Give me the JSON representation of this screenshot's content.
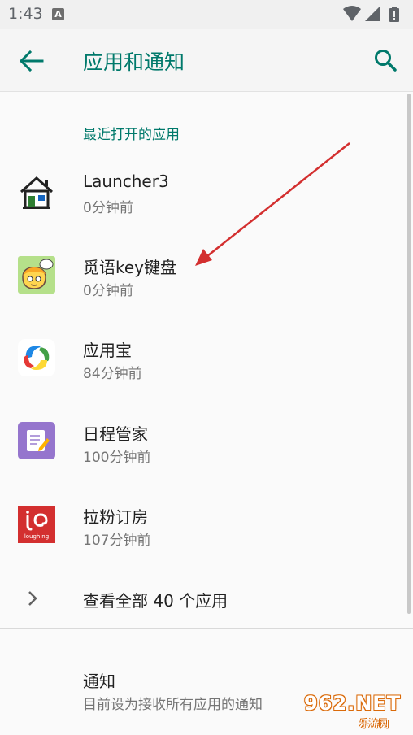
{
  "status_bar": {
    "time": "1:43",
    "notification_badge": "A",
    "icons": [
      "wifi-icon",
      "signal-icon",
      "battery-icon"
    ]
  },
  "header": {
    "title": "应用和通知",
    "back_icon": "back-arrow-icon",
    "search_icon": "search-icon"
  },
  "recent": {
    "section_title": "最近打开的应用",
    "apps": [
      {
        "name": "Launcher3",
        "time": "0分钟前",
        "icon": "launcher3-icon"
      },
      {
        "name": "觅语key键盘",
        "time": "0分钟前",
        "icon": "keyboard-app-icon"
      },
      {
        "name": "应用宝",
        "time": "84分钟前",
        "icon": "app-store-icon"
      },
      {
        "name": "日程管家",
        "time": "100分钟前",
        "icon": "schedule-icon"
      },
      {
        "name": "拉粉订房",
        "time": "107分钟前",
        "icon": "laughing-icon",
        "icon_text": "loughing"
      }
    ]
  },
  "see_all": {
    "label": "查看全部 40 个应用"
  },
  "notifications": {
    "title": "通知",
    "subtitle": "目前设为接收所有应用的通知"
  },
  "watermark": {
    "text": "962.NET",
    "sub": "乐游网"
  },
  "colors": {
    "accent": "#00796b",
    "annotation_arrow": "#d32f2f",
    "primary_text": "#212121",
    "secondary_text": "#757575"
  }
}
